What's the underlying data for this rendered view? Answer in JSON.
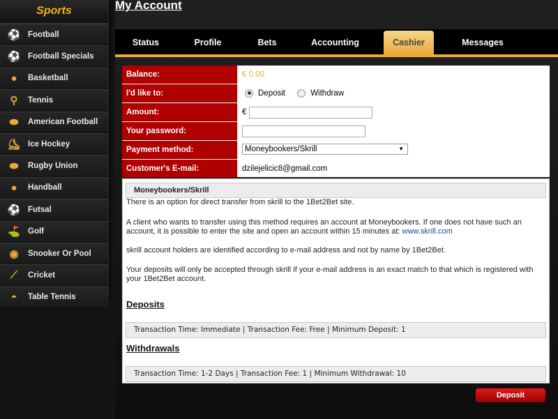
{
  "sidebar": {
    "title": "Sports",
    "items": [
      {
        "label": "Football",
        "icon": "soccer-ball-icon"
      },
      {
        "label": "Football Specials",
        "icon": "soccer-ball-icon"
      },
      {
        "label": "Basketball",
        "icon": "basketball-icon"
      },
      {
        "label": "Tennis",
        "icon": "tennis-player-icon"
      },
      {
        "label": "American Football",
        "icon": "american-football-icon"
      },
      {
        "label": "Ice Hockey",
        "icon": "ice-hockey-icon"
      },
      {
        "label": "Rugby Union",
        "icon": "rugby-ball-icon"
      },
      {
        "label": "Handball",
        "icon": "handball-icon"
      },
      {
        "label": "Futsal",
        "icon": "futsal-icon"
      },
      {
        "label": "Golf",
        "icon": "golfer-icon"
      },
      {
        "label": "Snooker Or Pool",
        "icon": "snooker-ball-icon"
      },
      {
        "label": "Cricket",
        "icon": "cricket-bat-icon"
      },
      {
        "label": "Table Tennis",
        "icon": "table-tennis-icon"
      }
    ]
  },
  "page": {
    "title": "My Account"
  },
  "tabs": [
    "Status",
    "Profile",
    "Bets",
    "Accounting",
    "Cashier",
    "Messages"
  ],
  "active_tab": "Cashier",
  "form": {
    "balance_label": "Balance:",
    "balance_value": "€ 0.00",
    "action_label": "I'd like to:",
    "deposit_option": "Deposit",
    "withdraw_option": "Withdraw",
    "selected_option": "Deposit",
    "amount_label": "Amount:",
    "currency_symbol": "€",
    "amount_value": "",
    "password_label": "Your password:",
    "password_value": "",
    "payment_label": "Payment method:",
    "payment_selected": "Moneybookers/Skrill",
    "email_label": "Customer's E-mail:",
    "email_value": "dzilejelicic8@gmail.com"
  },
  "info": {
    "header": "Moneybookers/Skrill",
    "para1": "There is an option for direct transfer from skrill to the 1Bet2Bet site.",
    "para2": "A client who wants to transfer using this method requires an account at Moneybookers. If one does not have such an account, it is possible to enter the site and open an account within 15 minutes at:",
    "link": "www.skrill.com",
    "para3": "skrill account holders are identified according to e-mail address and not by name by 1Bet2Bet.",
    "para4": "Your deposits will only be accepted through skrill if your e-mail address is an exact match to that which is registered with your 1Bet2Bet account.",
    "deposits_title": "Deposits",
    "deposits_details": "Transaction Time: Immediate | Transaction Fee: Free | Minimum Deposit: 1",
    "withdrawals_title": "Withdrawals",
    "withdrawals_details": "Transaction Time: 1-2 Days | Transaction Fee: 1 | Minimum Withdrawal: 10"
  },
  "actions": {
    "deposit_button": "Deposit"
  },
  "colors": {
    "accent": "#e9ab3a",
    "label_red": "#b10000",
    "balance_gold": "#e9ab3a"
  }
}
